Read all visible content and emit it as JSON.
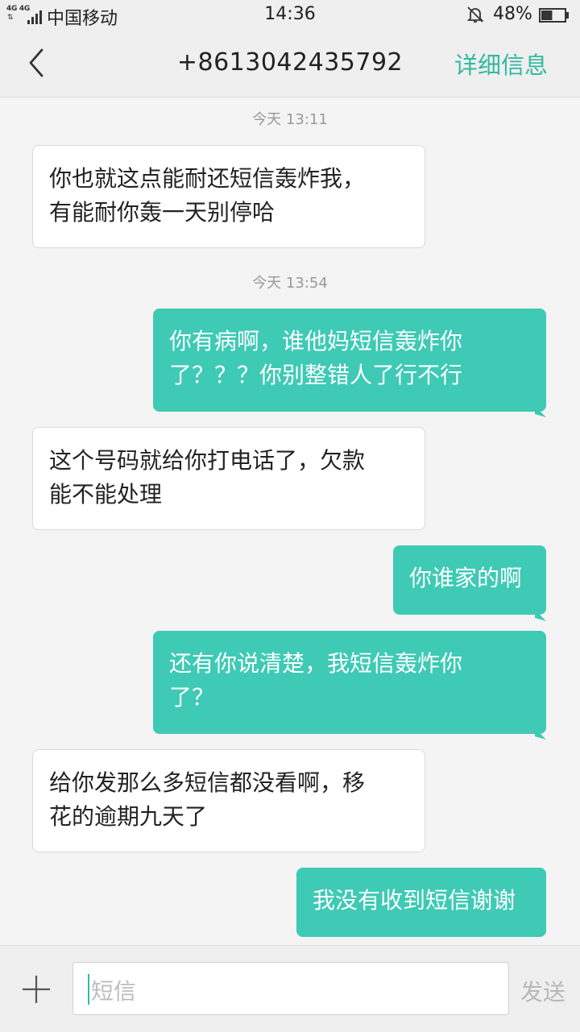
{
  "status_bar": {
    "network_label": "4G 4G",
    "carrier": "中国移动",
    "time": "14:36",
    "battery_percent": "48%",
    "battery_level": 0.48
  },
  "header": {
    "contact": "+8613042435792",
    "detail_label": "详细信息"
  },
  "messages": [
    {
      "type": "timestamp",
      "text": "今天  13:11"
    },
    {
      "type": "incoming",
      "lines": [
        "你也就这点能耐还短信轰炸我，",
        "有能耐你轰一天别停哈"
      ]
    },
    {
      "type": "timestamp",
      "text": "今天  13:54"
    },
    {
      "type": "outgoing",
      "lines": [
        "你有病啊，谁他妈短信轰炸你",
        "了？？？你别整错人了行不行"
      ]
    },
    {
      "type": "incoming",
      "lines": [
        "这个号码就给你打电话了，欠款",
        "能不能处理"
      ]
    },
    {
      "type": "outgoing",
      "lines": [
        "你谁家的啊"
      ]
    },
    {
      "type": "outgoing",
      "lines": [
        "还有你说清楚，我短信轰炸你",
        "了？"
      ]
    },
    {
      "type": "incoming",
      "lines": [
        "给你发那么多短信都没看啊，移",
        "花的逾期九天了"
      ]
    },
    {
      "type": "outgoing",
      "lines": [
        "我没有收到短信谢谢"
      ]
    }
  ],
  "composer": {
    "placeholder": "短信",
    "send_label": "发送"
  },
  "colors": {
    "accent": "#33b9a3",
    "outgoing_bubble": "#3ecab5",
    "incoming_bubble": "#ffffff",
    "background": "#f4f4f4"
  }
}
